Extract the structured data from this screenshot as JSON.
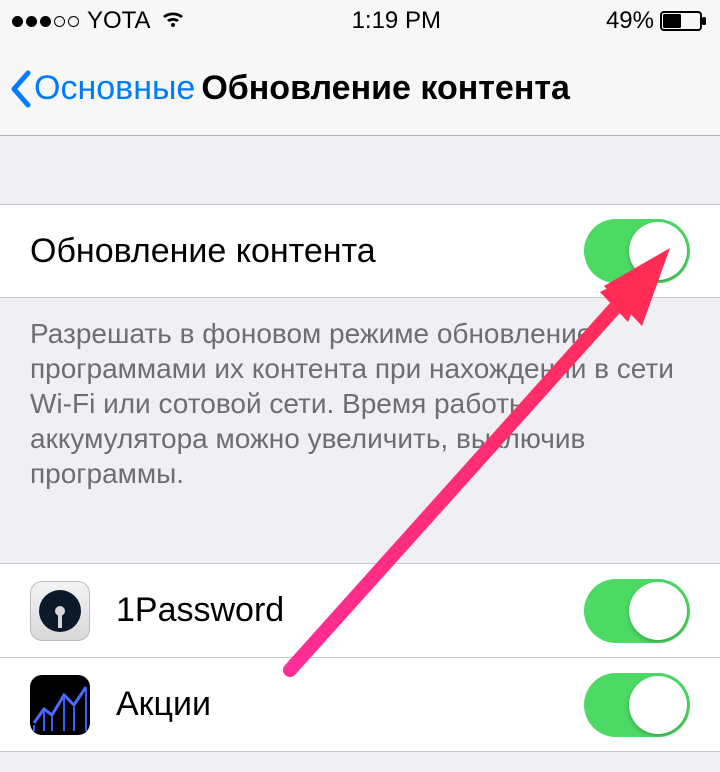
{
  "status_bar": {
    "carrier": "YOTA",
    "time": "1:19 PM",
    "battery_percent": "49%"
  },
  "nav": {
    "back_label": "Основные",
    "title": "Обновление контента"
  },
  "main_toggle": {
    "label": "Обновление контента",
    "on": true
  },
  "footer_text": "Разрешать в фоновом режиме обновление программами их контента при нахождении в сети Wi-Fi или сотовой сети. Время работы аккумулятора можно увеличить, выключив программы.",
  "apps": [
    {
      "name": "1Password",
      "icon": "1password-icon",
      "on": true
    },
    {
      "name": "Акции",
      "icon": "stocks-icon",
      "on": true
    }
  ]
}
